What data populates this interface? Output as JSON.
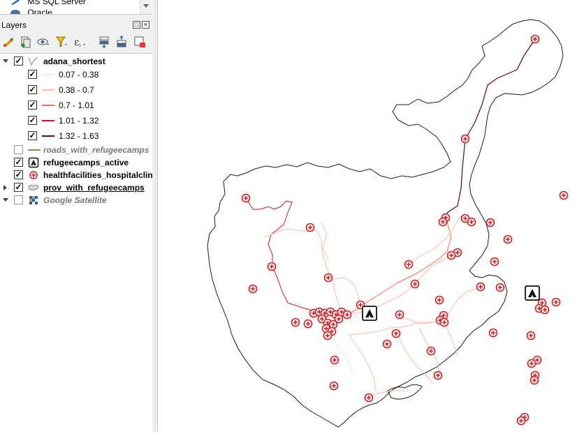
{
  "browser": {
    "items": [
      {
        "label": "MS SQL Server",
        "icon": "mssql-icon"
      },
      {
        "label": "Oracle",
        "icon": "oracle-icon"
      }
    ]
  },
  "layers_panel": {
    "title": "Layers",
    "toolbar": [
      "style-manager-icon",
      "add-group-icon",
      "visibility-icon",
      "filter-icon",
      "expression-filter-icon",
      "expand-all-icon",
      "collapse-all-icon",
      "remove-layer-icon"
    ],
    "layers": [
      {
        "name": "adana_shortest",
        "checked": true,
        "expanded": true,
        "style": "bold",
        "icon": "line-layer-icon",
        "classes": [
          {
            "label": "0.07 - 0.38",
            "color": "#fff5f0",
            "checked": true
          },
          {
            "label": "0.38 - 0.7",
            "color": "#fcbba1",
            "checked": true
          },
          {
            "label": "0.7 - 1.01",
            "color": "#fb6a4a",
            "checked": true
          },
          {
            "label": "1.01 - 1.32",
            "color": "#cb181d",
            "checked": true
          },
          {
            "label": "1.32 - 1.63",
            "color": "#67000d",
            "checked": true
          }
        ]
      },
      {
        "name": "roads_with_refugeecamps",
        "checked": false,
        "style": "italic",
        "icon": "line-swatch-icon",
        "color": "#6a9a4a"
      },
      {
        "name": "refugeecamps_active",
        "checked": true,
        "style": "bold",
        "icon": "tent-icon"
      },
      {
        "name": "healthfacilities_hospitalclinic",
        "checked": true,
        "style": "bold",
        "icon": "health-point-icon"
      },
      {
        "name": "prov_with_refugeecamps",
        "checked": true,
        "style": "bold-underline",
        "icon": "polygon-layer-icon",
        "collapsed": true
      },
      {
        "name": "Google Satellite",
        "checked": false,
        "style": "italic",
        "icon": "raster-icon",
        "expanded": true
      }
    ]
  },
  "map": {
    "boundary_color": "#1a1a1a",
    "facility_color": "#d7191c",
    "camp_symbol": "tent-icon"
  }
}
